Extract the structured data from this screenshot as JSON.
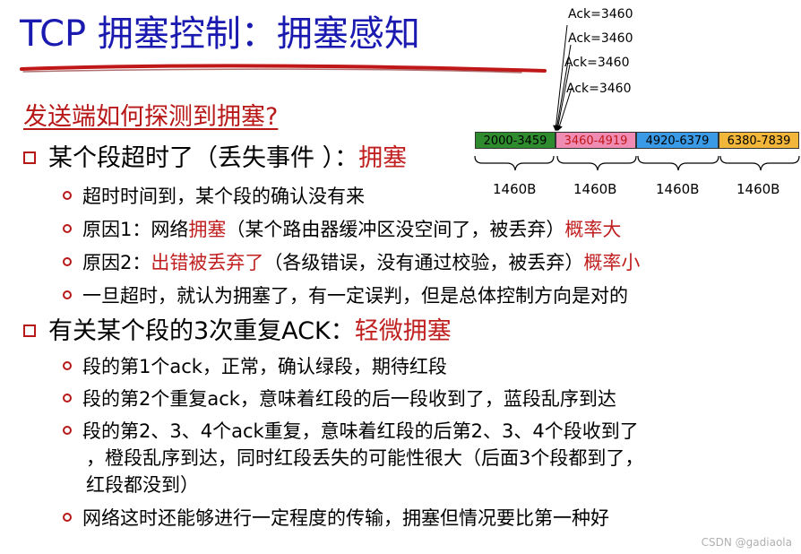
{
  "title": "TCP 拥塞控制：拥塞感知",
  "acks": [
    "Ack=3460",
    "Ack=3460",
    "Ack=3460",
    "Ack=3460"
  ],
  "segments": [
    {
      "label": "2000-3459",
      "color": "#2e8b2e",
      "text_color": "#000000"
    },
    {
      "label": "3460-4919",
      "color": "#f08cb4",
      "text_color": "#c01818"
    },
    {
      "label": "4920-6379",
      "color": "#3a9ae6",
      "text_color": "#000000"
    },
    {
      "label": "6380-7839",
      "color": "#f2b73a",
      "text_color": "#000000"
    }
  ],
  "bytes": [
    "1460B",
    "1460B",
    "1460B",
    "1460B"
  ],
  "subhead": "发送端如何探测到拥塞?",
  "b1": {
    "text": "某个段超时了（丢失事件 ）：",
    "red": "拥塞"
  },
  "b1_items": {
    "i1": "超时时间到，某个段的确认没有来",
    "i2_a": "原因1：网络",
    "i2_b": "拥塞",
    "i2_c": "（某个路由器缓冲区没空间了，被丢弃）",
    "i2_d": "概率大",
    "i3_a": "原因2：",
    "i3_b": "出错被丢弃了",
    "i3_c": "（各级错误，没有通过校验，被丢弃）",
    "i3_d": "概率小",
    "i4": "一旦超时，就认为拥塞了，有一定误判，但是总体控制方向是对的"
  },
  "b2": {
    "text": "有关某个段的3次重复ACK：",
    "red": "轻微拥塞"
  },
  "b2_items": {
    "i1": "段的第1个ack，正常，确认绿段，期待红段",
    "i2": "段的第2个重复ack，意味着红段的后一段收到了，蓝段乱序到达",
    "i3_l1": "段的第2、3、4个ack重复，意味着红段的后第2、3、4个段收到了",
    "i3_l2": "，橙段乱序到达，同时红段丢失的可能性很大（后面3个段都到了，",
    "i3_l3": "红段都没到）",
    "i4": "网络这时还能够进行一定程度的传输，拥塞但情况要比第一种好"
  },
  "watermark": "CSDN @gadiaola"
}
